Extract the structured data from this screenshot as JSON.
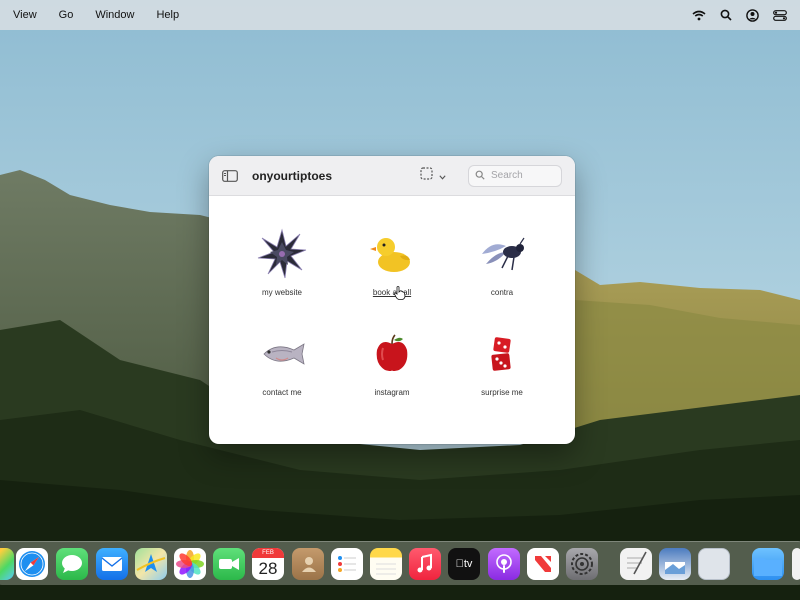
{
  "menubar": {
    "items": [
      "View",
      "Go",
      "Window",
      "Help"
    ]
  },
  "window": {
    "title": "onyourtiptoes",
    "search_placeholder": "Search"
  },
  "items": [
    {
      "label": "my website",
      "icon": "spiky-star-icon"
    },
    {
      "label": "book a call",
      "icon": "rubber-duck-icon"
    },
    {
      "label": "contra",
      "icon": "wasp-icon"
    },
    {
      "label": "contact me",
      "icon": "fish-icon"
    },
    {
      "label": "instagram",
      "icon": "apple-icon"
    },
    {
      "label": "surprise me",
      "icon": "red-dice-icon"
    }
  ],
  "dock": {
    "calendar_month": "FEB",
    "calendar_day": "28",
    "tv_label": "tv"
  },
  "colors": {
    "window_bg": "#ffffff",
    "titlebar_bg": "#efeff1",
    "menubar_bg": "#d7dee2"
  }
}
